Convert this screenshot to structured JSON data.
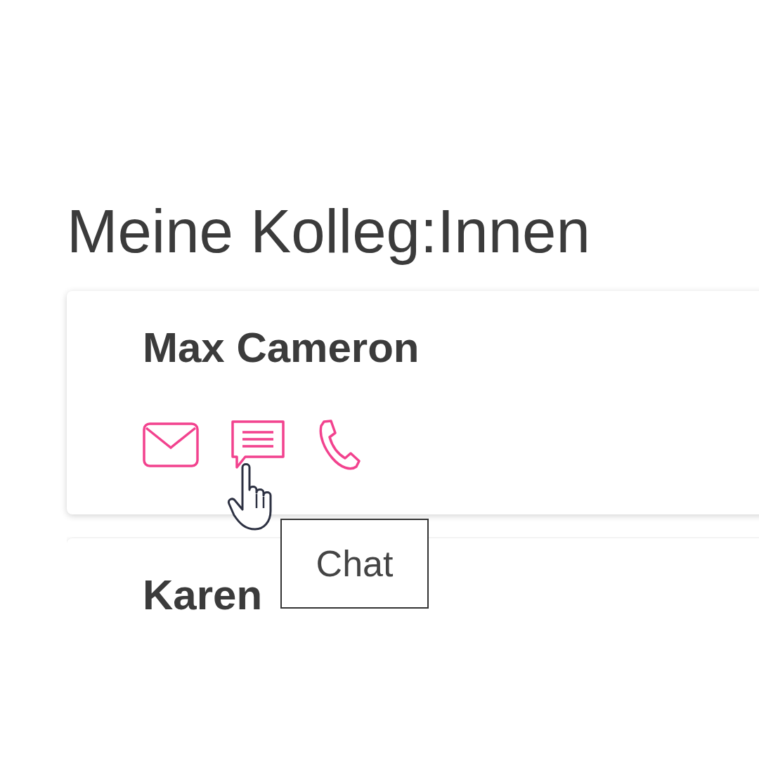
{
  "heading": "Meine Kolleg:Innen",
  "colleagues": [
    {
      "name": "Max Cameron",
      "actions": [
        {
          "kind": "mail"
        },
        {
          "kind": "chat"
        },
        {
          "kind": "phone"
        }
      ]
    },
    {
      "name": "Karen"
    }
  ],
  "tooltip": {
    "text": "Chat"
  }
}
